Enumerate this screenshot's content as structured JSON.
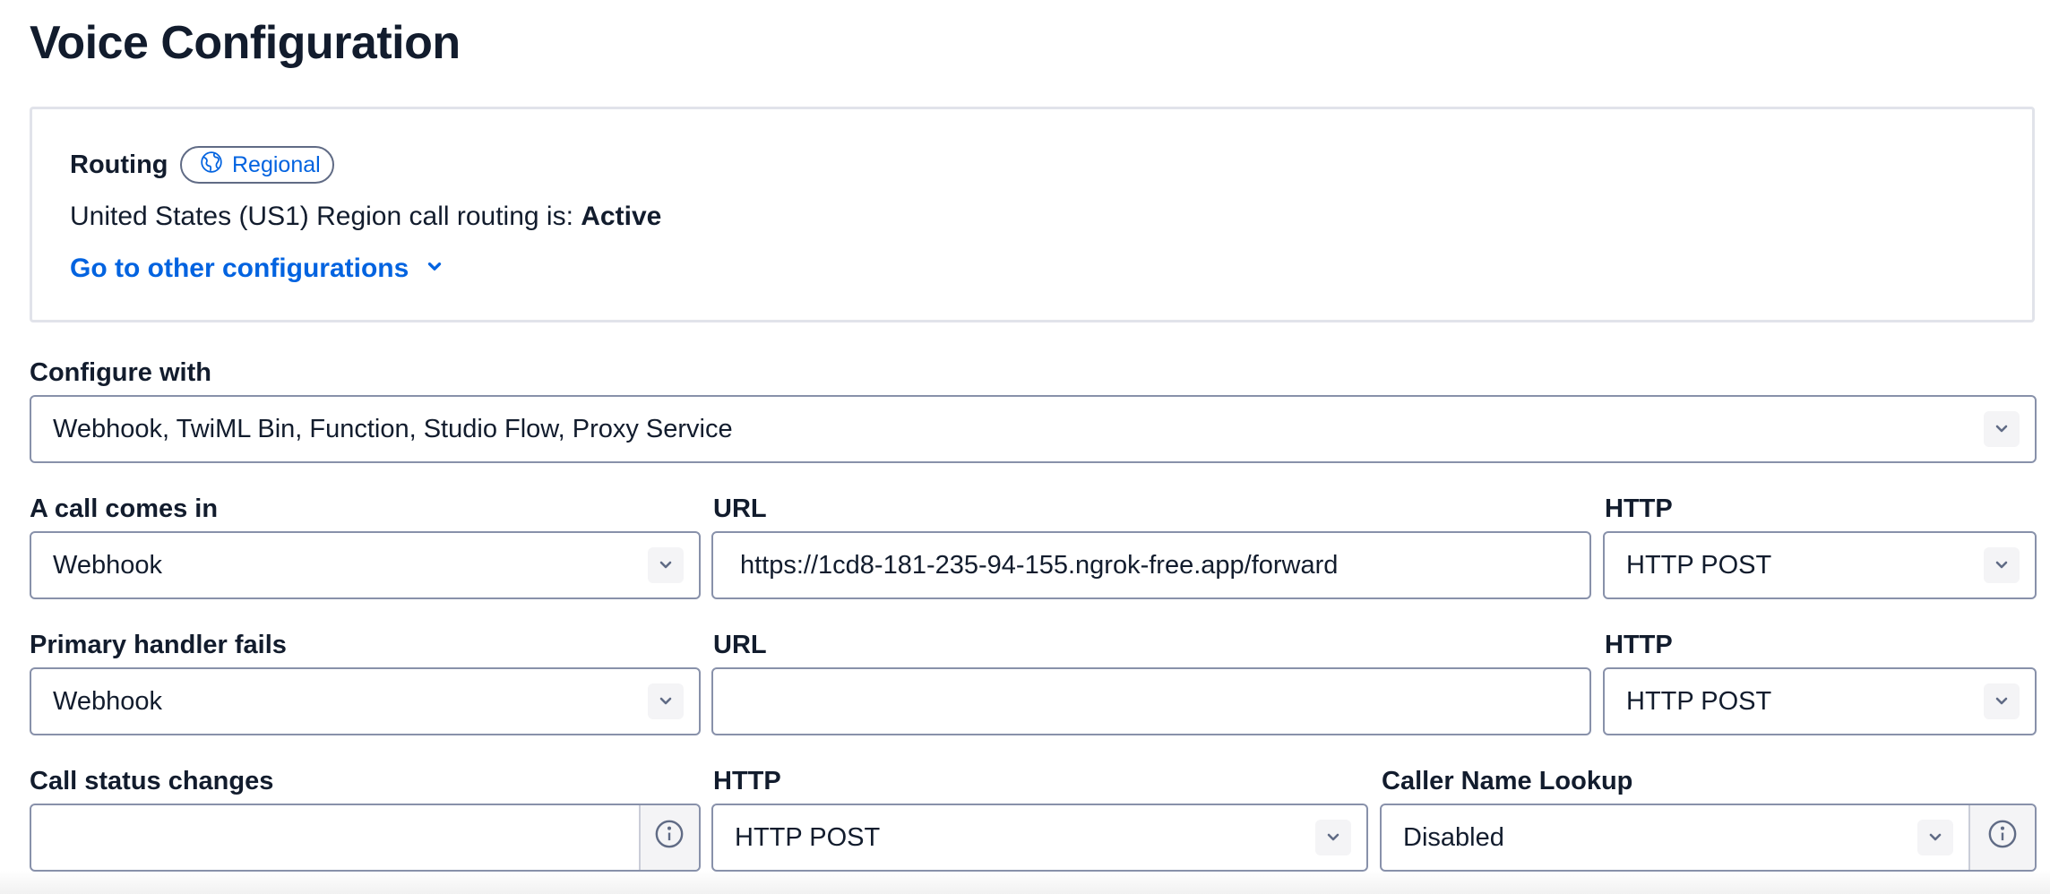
{
  "page": {
    "title": "Voice Configuration"
  },
  "routing": {
    "label": "Routing",
    "badge": "Regional",
    "status_prefix": "United States (US1) Region call routing is: ",
    "status_value": "Active",
    "other_configs_link": "Go to other configurations"
  },
  "configure_with": {
    "label": "Configure with",
    "value": "Webhook, TwiML Bin, Function, Studio Flow, Proxy Service"
  },
  "call_comes_in": {
    "label": "A call comes in",
    "type": "Webhook",
    "url_label": "URL",
    "url": "https://1cd8-181-235-94-155.ngrok-free.app/forward",
    "http_label": "HTTP",
    "http_method": "HTTP POST"
  },
  "primary_handler_fails": {
    "label": "Primary handler fails",
    "type": "Webhook",
    "url_label": "URL",
    "url": "",
    "http_label": "HTTP",
    "http_method": "HTTP POST"
  },
  "call_status_changes": {
    "label": "Call status changes",
    "url": "",
    "http_label": "HTTP",
    "http_method": "HTTP POST"
  },
  "caller_name_lookup": {
    "label": "Caller Name Lookup",
    "value": "Disabled"
  },
  "icons": {
    "badge": "globe-icon",
    "chevron": "chevron-down-icon",
    "info": "info-icon"
  },
  "colors": {
    "link": "#0263e0",
    "text": "#121c2d",
    "border": "#8891aa"
  }
}
